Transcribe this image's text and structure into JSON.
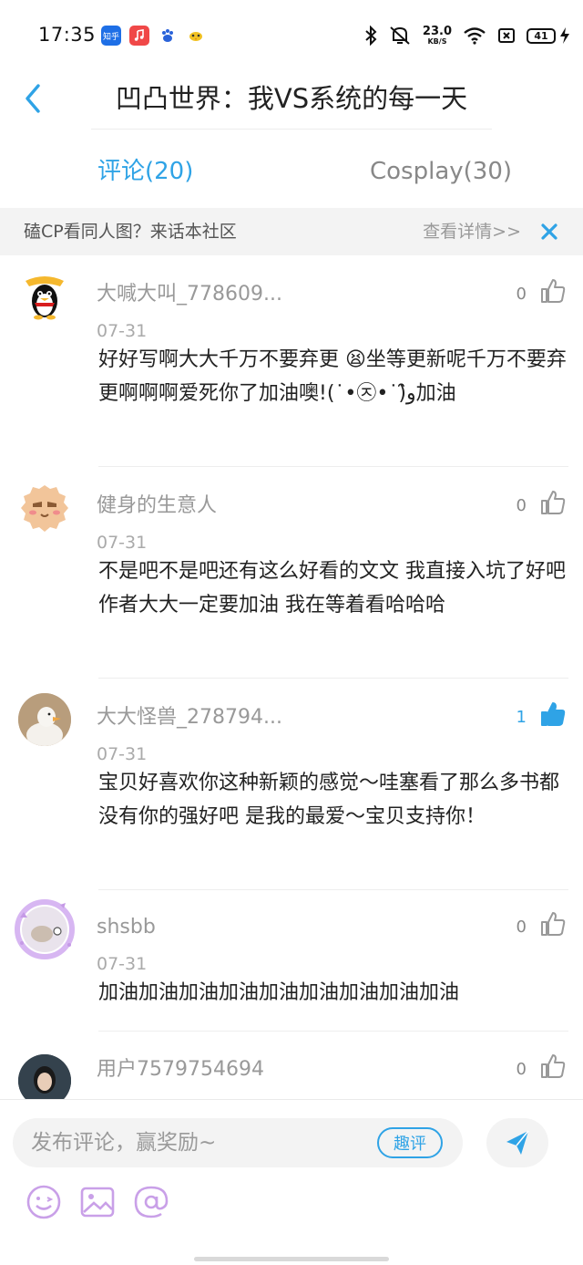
{
  "status_bar": {
    "time": "17:35",
    "app_icons": [
      "zhihu-app-icon",
      "music-app-icon",
      "baidu-app-icon",
      "bird-app-icon"
    ],
    "app_icon_zhihu_label": "知乎",
    "net_speed_value": "23.0",
    "net_speed_unit": "KB/S",
    "battery": "41"
  },
  "header": {
    "title": "凹凸世界：我VS系统的每一天"
  },
  "tabs": [
    {
      "label": "评论(20)",
      "active": true
    },
    {
      "label": "Cosplay(30)",
      "active": false
    }
  ],
  "banner": {
    "text": "磕CP看同人图？来话本社区",
    "link": "查看详情>>"
  },
  "comments": [
    {
      "username": "大喊大叫_778609...",
      "date": "07-31",
      "text": "好好写啊大大千万不要弃更 😫坐等更新呢千万不要弃更啊啊啊爱死你了加油噢!(˙•㉨•˙)و̑̑加油",
      "likes": "0",
      "liked": false
    },
    {
      "username": "健身的生意人",
      "date": "07-31",
      "text": "不是吧不是吧还有这么好看的文文 我直接入坑了好吧 作者大大一定要加油 我在等着看哈哈哈",
      "likes": "0",
      "liked": false
    },
    {
      "username": "大大怪兽_278794...",
      "date": "07-31",
      "text": "宝贝好喜欢你这种新颖的感觉～哇塞看了那么多书都没有你的强好吧 是我的最爱～宝贝支持你！",
      "likes": "1",
      "liked": true
    },
    {
      "username": "shsbb",
      "date": "07-31",
      "text": "加油加油加油加油加油加油加油加油加油",
      "likes": "0",
      "liked": false
    },
    {
      "username": "用户7579754694",
      "date": "",
      "text": "",
      "likes": "0",
      "liked": false
    }
  ],
  "input": {
    "placeholder": "发布评论，赢奖励~",
    "quping_label": "趣评"
  },
  "colors": {
    "accent": "#2fa3e6",
    "tool_icon": "#c9a0e8"
  }
}
